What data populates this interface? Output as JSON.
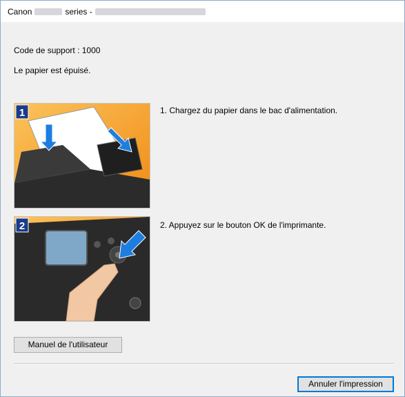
{
  "window": {
    "title_prefix": "Canon",
    "title_middle": "series -"
  },
  "message": {
    "support_code": "Code de support : 1000",
    "description": "Le papier est épuisé."
  },
  "steps": [
    {
      "number": "1",
      "text": "1.  Chargez du papier dans le bac d'alimentation."
    },
    {
      "number": "2",
      "text": "2.  Appuyez sur le bouton OK de l'imprimante."
    }
  ],
  "buttons": {
    "manual_label": "Manuel de l'utilisateur",
    "cancel_label": "Annuler l'impression"
  },
  "colors": {
    "accent": "#0078d7",
    "badge": "#1a3a8a",
    "illustration_orange": "#f7a21b"
  }
}
